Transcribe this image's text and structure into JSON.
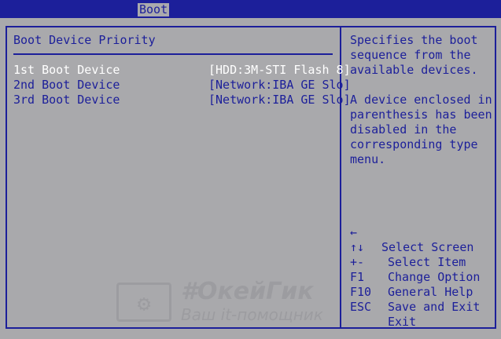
{
  "header": {
    "tab_label": "Boot"
  },
  "main": {
    "section_title": "Boot Device Priority",
    "devices": [
      {
        "label": "1st Boot Device",
        "value": "[HDD:3M-STI Flash 8]"
      },
      {
        "label": "2nd Boot Device",
        "value": "[Network:IBA GE Slo]"
      },
      {
        "label": "3rd Boot Device",
        "value": "[Network:IBA GE Slo]"
      }
    ]
  },
  "help": {
    "line1": "Specifies the boot",
    "line2": "sequence from the",
    "line3": "available devices.",
    "line4": "A device enclosed in",
    "line5": "parenthesis has been",
    "line6": "disabled in the",
    "line7": "corresponding type",
    "line8": "menu."
  },
  "keys": [
    {
      "key": "←",
      "desc": "Select Screen"
    },
    {
      "key": "↑↓",
      "desc": "Select Item"
    },
    {
      "key": "+-",
      "desc": "Change Option"
    },
    {
      "key": "F1",
      "desc": "General Help"
    },
    {
      "key": "F10",
      "desc": "Save and Exit"
    },
    {
      "key": "ESC",
      "desc": "Exit"
    }
  ],
  "watermark": {
    "title": "#ОкейГик",
    "subtitle": "Ваш it-помощник",
    "icon": "gear-icon"
  },
  "colors": {
    "background": "#a9a9ac",
    "accent": "#1c1f9a",
    "selected_text": "#ffffff"
  }
}
